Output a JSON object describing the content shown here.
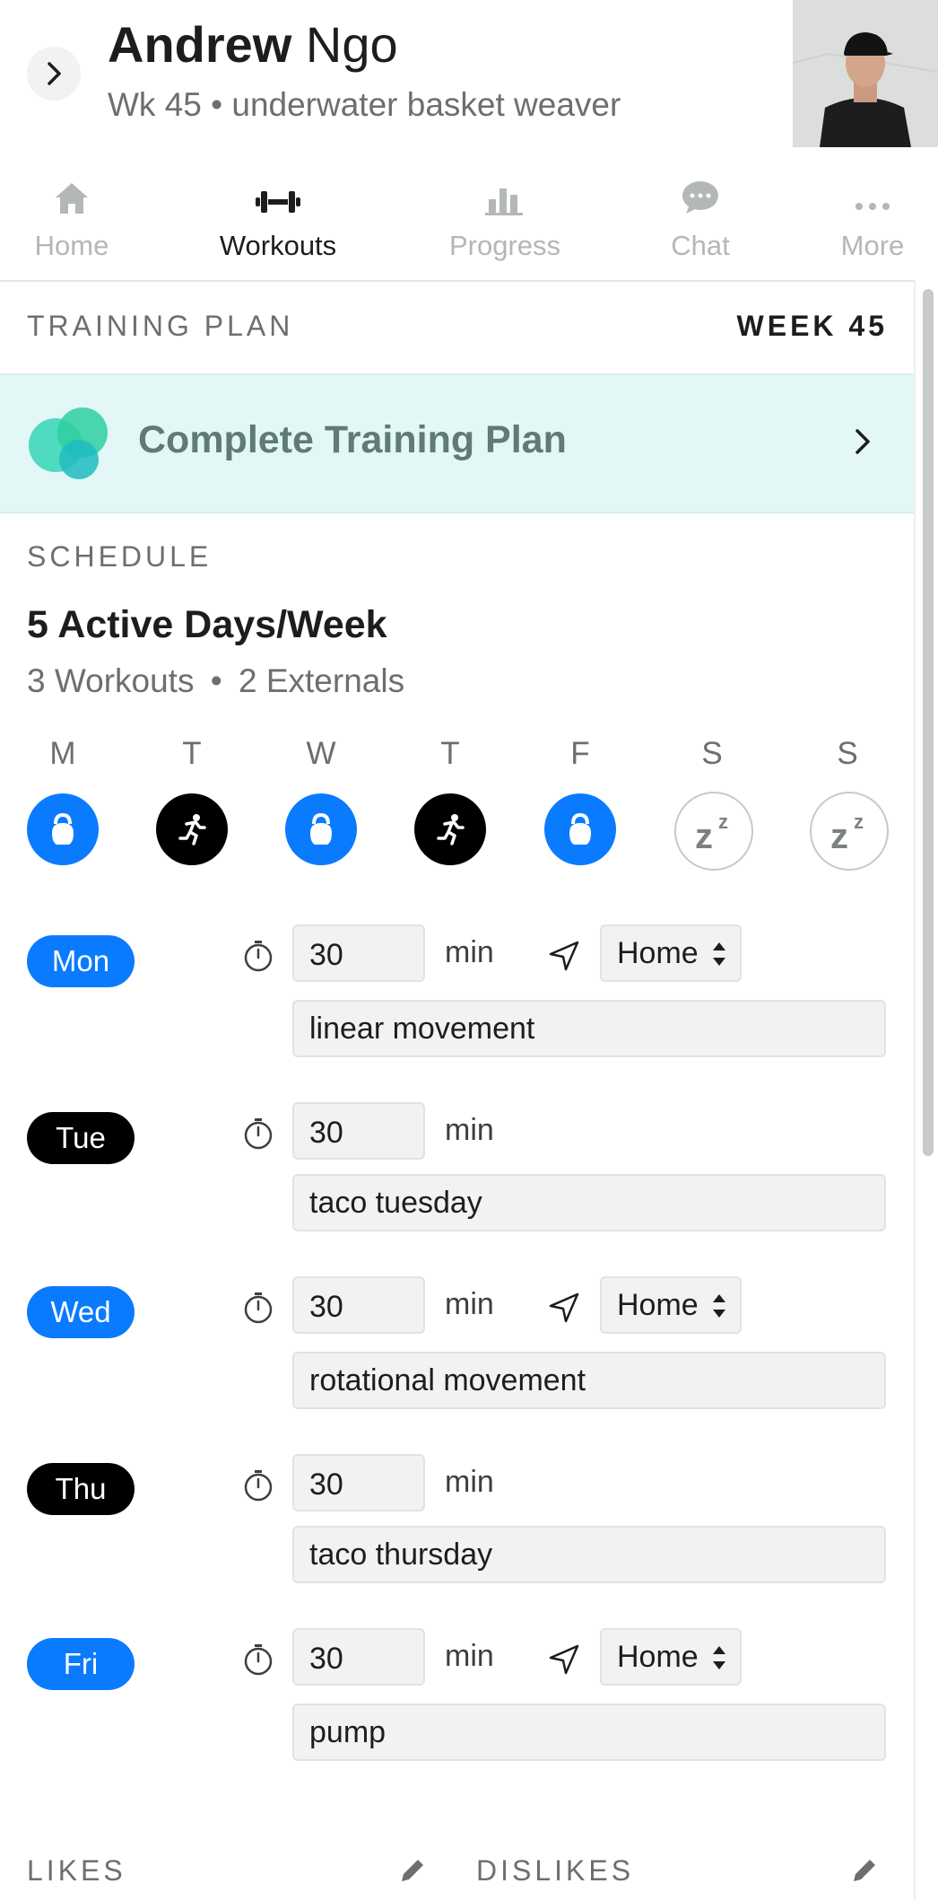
{
  "header": {
    "first_name": "Andrew",
    "last_name": "Ngo",
    "subtitle": "Wk 45 • underwater basket weaver"
  },
  "nav": {
    "items": [
      {
        "label": "Home",
        "icon": "home-icon",
        "active": false
      },
      {
        "label": "Workouts",
        "icon": "dumbbell-icon",
        "active": true
      },
      {
        "label": "Progress",
        "icon": "bar-chart-icon",
        "active": false
      },
      {
        "label": "Chat",
        "icon": "chat-bubble-icon",
        "active": false
      },
      {
        "label": "More",
        "icon": "more-dots-icon",
        "active": false
      }
    ]
  },
  "training_plan": {
    "heading": "TRAINING PLAN",
    "week": "WEEK 45",
    "banner_title": "Complete Training Plan"
  },
  "schedule": {
    "heading": "SCHEDULE",
    "title": "5 Active Days/Week",
    "workouts": "3 Workouts",
    "externals": "2 Externals",
    "separator": "•",
    "days": [
      {
        "letter": "M",
        "type": "kettlebell"
      },
      {
        "letter": "T",
        "type": "run"
      },
      {
        "letter": "W",
        "type": "kettlebell"
      },
      {
        "letter": "T",
        "type": "run"
      },
      {
        "letter": "F",
        "type": "kettlebell"
      },
      {
        "letter": "S",
        "type": "rest"
      },
      {
        "letter": "S",
        "type": "rest"
      }
    ]
  },
  "entries": [
    {
      "day": "Mon",
      "minutes": "30",
      "unit": "min",
      "location": "Home",
      "name": "linear movement"
    },
    {
      "day": "Tue",
      "minutes": "30",
      "unit": "min",
      "name": "taco tuesday"
    },
    {
      "day": "Wed",
      "minutes": "30",
      "unit": "min",
      "location": "Home",
      "name": "rotational movement"
    },
    {
      "day": "Thu",
      "minutes": "30",
      "unit": "min",
      "name": "taco thursday"
    },
    {
      "day": "Fri",
      "minutes": "30",
      "unit": "min",
      "location": "Home",
      "name": "pump"
    }
  ],
  "preferences": {
    "likes": "LIKES",
    "dislikes": "DISLIKES"
  },
  "colors": {
    "accent_blue": "#0a7bff",
    "banner_bg": "#e4f7f7",
    "teal": "#3fd6b8"
  }
}
